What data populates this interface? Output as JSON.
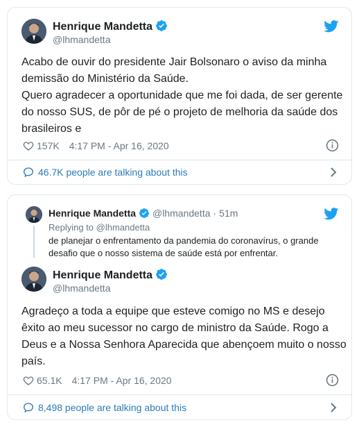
{
  "tweet1": {
    "author_name": "Henrique Mandetta",
    "author_handle": "@lhmandetta",
    "text": "Acabo de ouvir do presidente Jair Bolsonaro o aviso da minha demissão do Ministério da Saúde.\nQuero agradecer a oportunidade que me foi dada, de ser gerente do nosso SUS, de pôr de pé o projeto de melhoria da saúde dos brasileiros e",
    "likes": "157K",
    "timestamp": "4:17 PM - Apr 16, 2020",
    "talking": "46.7K people are talking about this"
  },
  "tweet2": {
    "reply_context": {
      "author_name": "Henrique Mandetta",
      "author_handle": "@lhmandetta",
      "age": "51m",
      "replying_prefix": "Replying to",
      "replying_handle": "@lhmandetta",
      "text": "de planejar o enfrentamento da pandemia do coronavírus, o grande desafio que o nosso sistema de saúde está por enfrentar."
    },
    "author_name": "Henrique Mandetta",
    "author_handle": "@lhmandetta",
    "text": "Agradeço a toda a equipe que esteve comigo no MS e desejo êxito ao meu sucessor no cargo de ministro da Saúde. Rogo a Deus e a Nossa Senhora Aparecida que abençoem muito o nosso país.",
    "likes": "65.1K",
    "timestamp": "4:17 PM - Apr 16, 2020",
    "talking": "8,498 people are talking about this"
  },
  "icons": {
    "verified": "verified-badge-icon",
    "twitter": "twitter-bird-icon",
    "like": "heart-icon",
    "info": "info-icon",
    "comment": "speech-bubble-icon",
    "chevron": "chevron-right-icon"
  },
  "colors": {
    "brand_blue": "#1da1f2",
    "link_blue": "#2b7bb9",
    "text": "#1c2022",
    "muted": "#697882",
    "border": "#e1e8ed"
  }
}
